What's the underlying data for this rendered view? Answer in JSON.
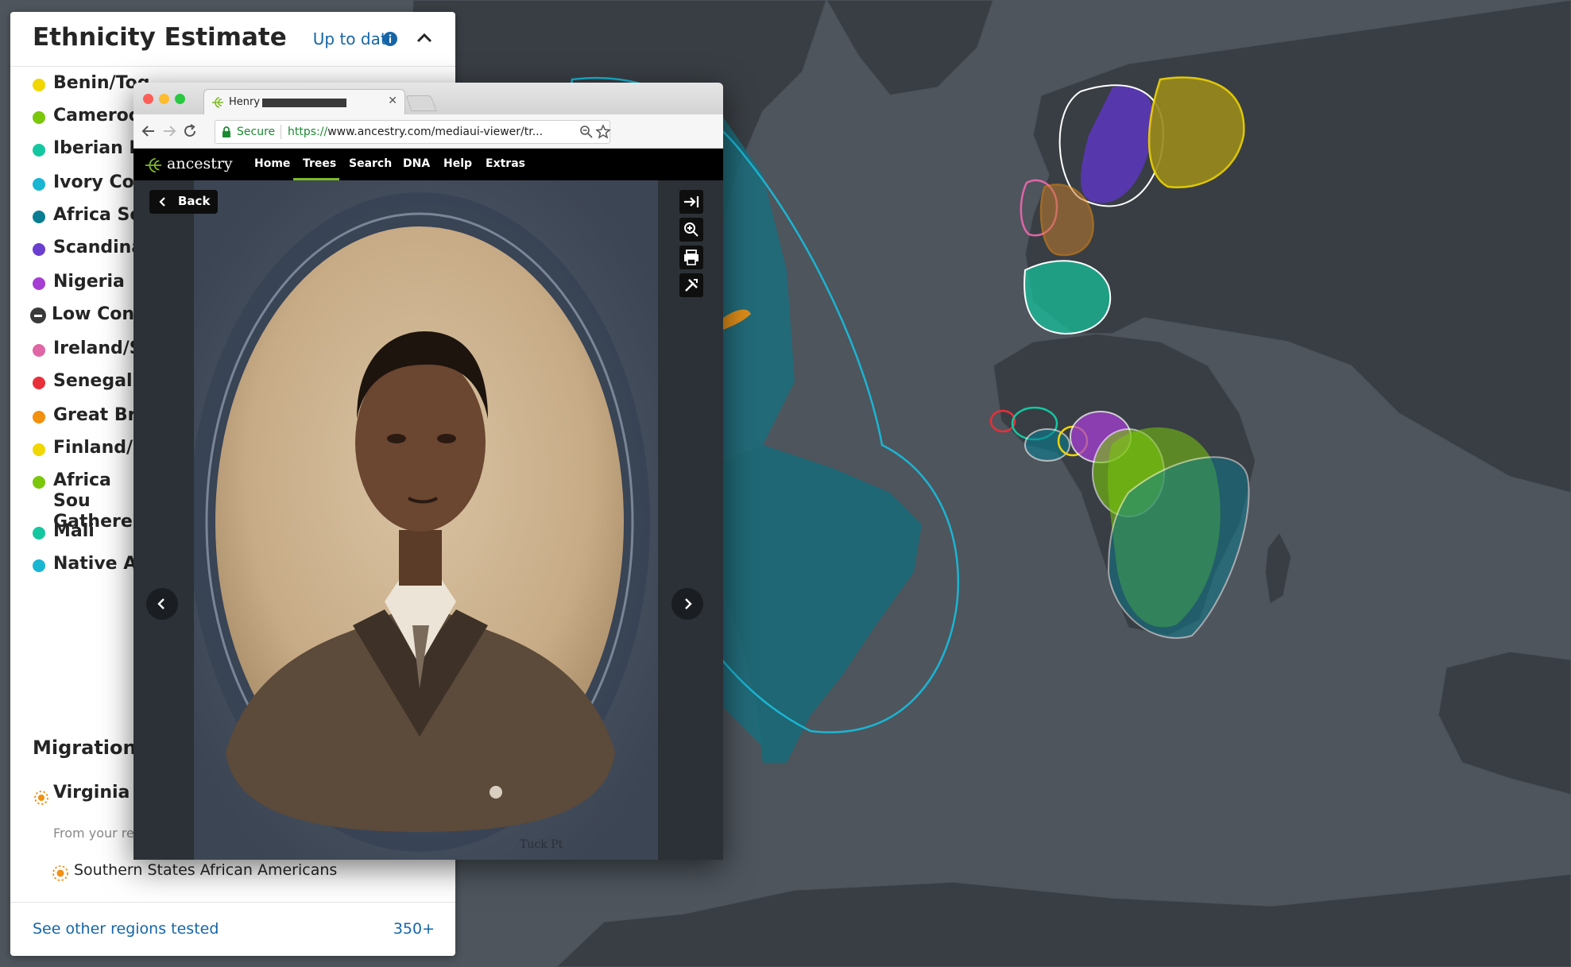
{
  "panel": {
    "title": "Ethnicity Estimate",
    "status": "Up to date",
    "ethnicities": [
      {
        "label": "Benin/Tog",
        "color": "#f2d600",
        "icon": "dot"
      },
      {
        "label": "Cameroon",
        "color": "#7ac70c",
        "icon": "dot"
      },
      {
        "label": "Iberian Pe",
        "color": "#14c7a0",
        "icon": "dot"
      },
      {
        "label": "Ivory Coa",
        "color": "#19b5d3",
        "icon": "dot"
      },
      {
        "label": "Africa Sou",
        "color": "#0a7d92",
        "icon": "dot"
      },
      {
        "label": "Scandina",
        "color": "#6a3ecf",
        "icon": "dot"
      },
      {
        "label": "Nigeria",
        "color": "#a63ed3",
        "icon": "dot"
      },
      {
        "label": "Low Confi",
        "color": "#3a3a3a",
        "icon": "minus-circle"
      },
      {
        "label": "Ireland/Sc",
        "color": "#e066a6",
        "icon": "dot"
      },
      {
        "label": "Senegal",
        "color": "#e8303a",
        "icon": "dot"
      },
      {
        "label": "Great Brit",
        "color": "#f2900f",
        "icon": "dot"
      },
      {
        "label": "Finland/N",
        "color": "#f2d600",
        "icon": "dot"
      },
      {
        "label": "Africa Sou Gatherers",
        "color": "#7ac70c",
        "icon": "dot"
      },
      {
        "label": "Mali",
        "color": "#14c7a0",
        "icon": "dot"
      },
      {
        "label": "Native Am",
        "color": "#19b5d3",
        "icon": "dot"
      }
    ],
    "migrations_title": "Migrations",
    "migrations": [
      {
        "title": "Virginia & American",
        "subtitle": "From your re",
        "icon": "sun-icon"
      },
      {
        "title": "Southern States African Americans",
        "icon": "sun-icon"
      }
    ],
    "footer_link": "See other regions tested",
    "footer_count": "350+"
  },
  "browser": {
    "tab_title": "Henry",
    "secure_label": "Secure",
    "url_scheme": "https://",
    "url_rest": "www.ancestry.com/mediaui-viewer/tr...",
    "site_name": "ancestry",
    "nav": [
      "Home",
      "Trees",
      "Search",
      "DNA",
      "Help",
      "Extras"
    ],
    "active_nav": "Trees",
    "back_label": "Back",
    "tools": [
      "expand-icon",
      "zoom-icon",
      "print-icon",
      "tools-icon"
    ]
  },
  "colors": {
    "map_background": "#4e555d",
    "land": "#3a3f45",
    "accent_blue": "#1565a8",
    "ancestry_green": "#7db928"
  }
}
